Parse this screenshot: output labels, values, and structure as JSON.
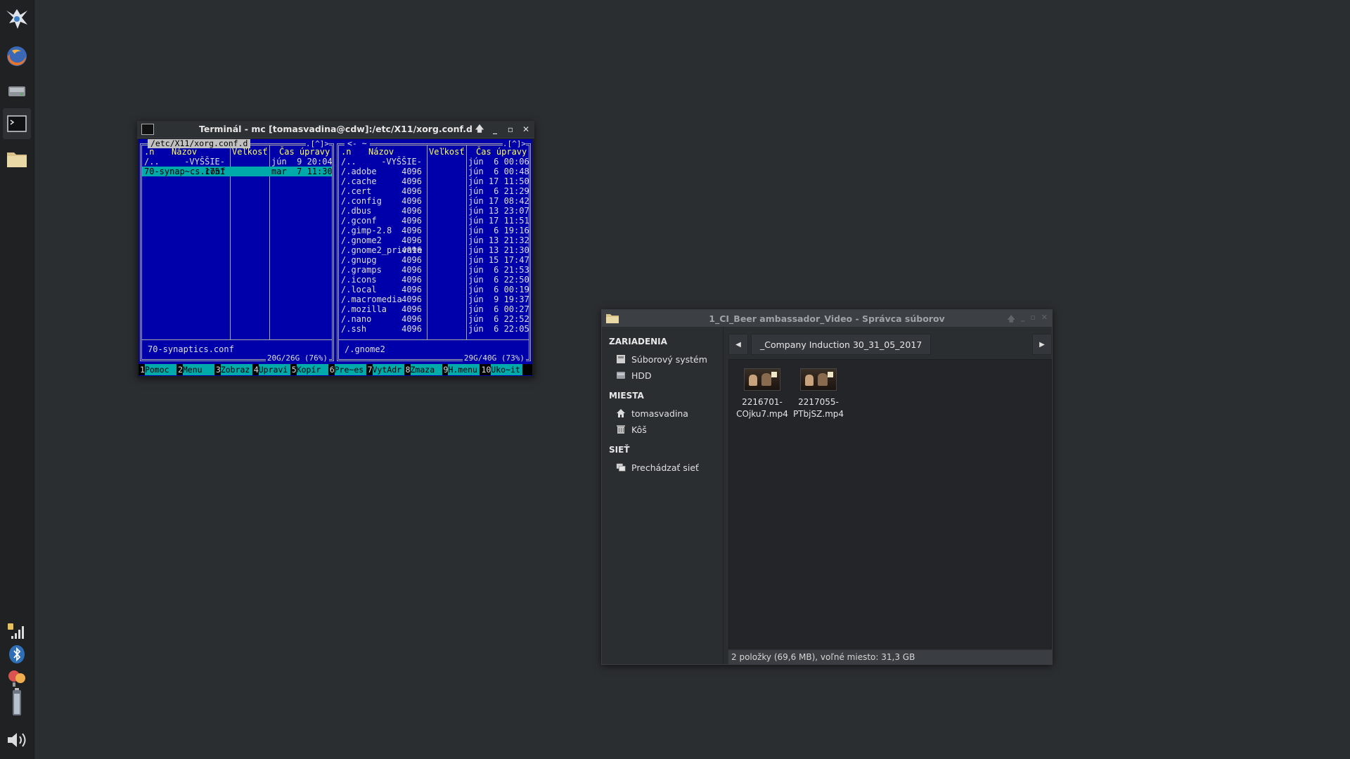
{
  "terminal": {
    "title": "Terminál - mc [tomasvadina@cdw]:/etc/X11/xorg.conf.d",
    "left_panel": {
      "path": "/etc/X11/xorg.conf.d",
      "corner": ".[^]>",
      "sort": ".n",
      "headers": {
        "name": "Názov",
        "size": "Veľkosť",
        "mtime": "Čas úpravy"
      },
      "rows": [
        {
          "name": "/..",
          "size": "-VYŠŠIE-",
          "mtime": "jún  9 20:04"
        },
        {
          "name": "70-synap~cs.conf",
          "size": "1751",
          "mtime": "mar  7 11:30"
        }
      ],
      "footer": "70-synaptics.conf",
      "disk": "20G/26G (76%)"
    },
    "right_panel": {
      "path": "<- ~",
      "corner": ".[^]>",
      "sort": ".n",
      "headers": {
        "name": "Názov",
        "size": "Veľkosť",
        "mtime": "Čas úpravy"
      },
      "rows": [
        {
          "name": "/..",
          "size": "-VYŠŠIE-",
          "mtime": "jún  6 00:06"
        },
        {
          "name": "/.adobe",
          "size": "4096",
          "mtime": "jún  6 00:48"
        },
        {
          "name": "/.cache",
          "size": "4096",
          "mtime": "jún 17 11:50"
        },
        {
          "name": "/.cert",
          "size": "4096",
          "mtime": "jún  6 21:29"
        },
        {
          "name": "/.config",
          "size": "4096",
          "mtime": "jún 17 08:42"
        },
        {
          "name": "/.dbus",
          "size": "4096",
          "mtime": "jún 13 23:07"
        },
        {
          "name": "/.gconf",
          "size": "4096",
          "mtime": "jún 17 11:51"
        },
        {
          "name": "/.gimp-2.8",
          "size": "4096",
          "mtime": "jún  6 19:16"
        },
        {
          "name": "/.gnome2",
          "size": "4096",
          "mtime": "jún 13 21:32"
        },
        {
          "name": "/.gnome2_private",
          "size": "4096",
          "mtime": "jún 13 21:30"
        },
        {
          "name": "/.gnupg",
          "size": "4096",
          "mtime": "jún 15 17:47"
        },
        {
          "name": "/.gramps",
          "size": "4096",
          "mtime": "jún  6 21:53"
        },
        {
          "name": "/.icons",
          "size": "4096",
          "mtime": "jún  6 22:50"
        },
        {
          "name": "/.local",
          "size": "4096",
          "mtime": "jún  6 00:19"
        },
        {
          "name": "/.macromedia",
          "size": "4096",
          "mtime": "jún  9 19:37"
        },
        {
          "name": "/.mozilla",
          "size": "4096",
          "mtime": "jún  6 00:27"
        },
        {
          "name": "/.nano",
          "size": "4096",
          "mtime": "jún  6 22:52"
        },
        {
          "name": "/.ssh",
          "size": "4096",
          "mtime": "jún  6 22:05"
        }
      ],
      "footer": "/.gnome2",
      "disk": "29G/40G (73%)"
    },
    "fkeys": [
      {
        "n": "1",
        "label": "Pomoc"
      },
      {
        "n": "2",
        "label": "Menu"
      },
      {
        "n": "3",
        "label": "Zobraz"
      },
      {
        "n": "4",
        "label": "Upravi"
      },
      {
        "n": "5",
        "label": "Kopír"
      },
      {
        "n": "6",
        "label": "Pre~es"
      },
      {
        "n": "7",
        "label": "VytAdr"
      },
      {
        "n": "8",
        "label": "Zmaza"
      },
      {
        "n": "9",
        "label": "H.menu"
      },
      {
        "n": "10",
        "label": "Uko~it"
      }
    ]
  },
  "filemanager": {
    "title": "1_CI_Beer ambassador_Video - Správca súborov",
    "sidebar": {
      "devices_header": "ZARIADENIA",
      "devices": [
        "Súborový systém",
        "HDD"
      ],
      "places_header": "MIESTA",
      "places": [
        "tomasvadina",
        "Kôš"
      ],
      "network_header": "SIEŤ",
      "network": [
        "Prechádzať sieť"
      ]
    },
    "breadcrumb": "_Company Induction 30_31_05_2017",
    "files": [
      {
        "line1": "2216701-",
        "line2": "COjku7.mp4"
      },
      {
        "line1": "2217055-",
        "line2": "PTbjSZ.mp4"
      }
    ],
    "status": "2 položky (69,6 MB), voľné miesto: 31,3 GB"
  },
  "dock": {
    "apps": [
      "xfce-logo-icon",
      "firefox-icon",
      "drive-icon",
      "terminal-icon",
      "folder-icon"
    ],
    "tray": [
      "network-icon",
      "bluetooth-icon",
      "update-icon",
      "battery-icon",
      "volume-icon"
    ]
  }
}
